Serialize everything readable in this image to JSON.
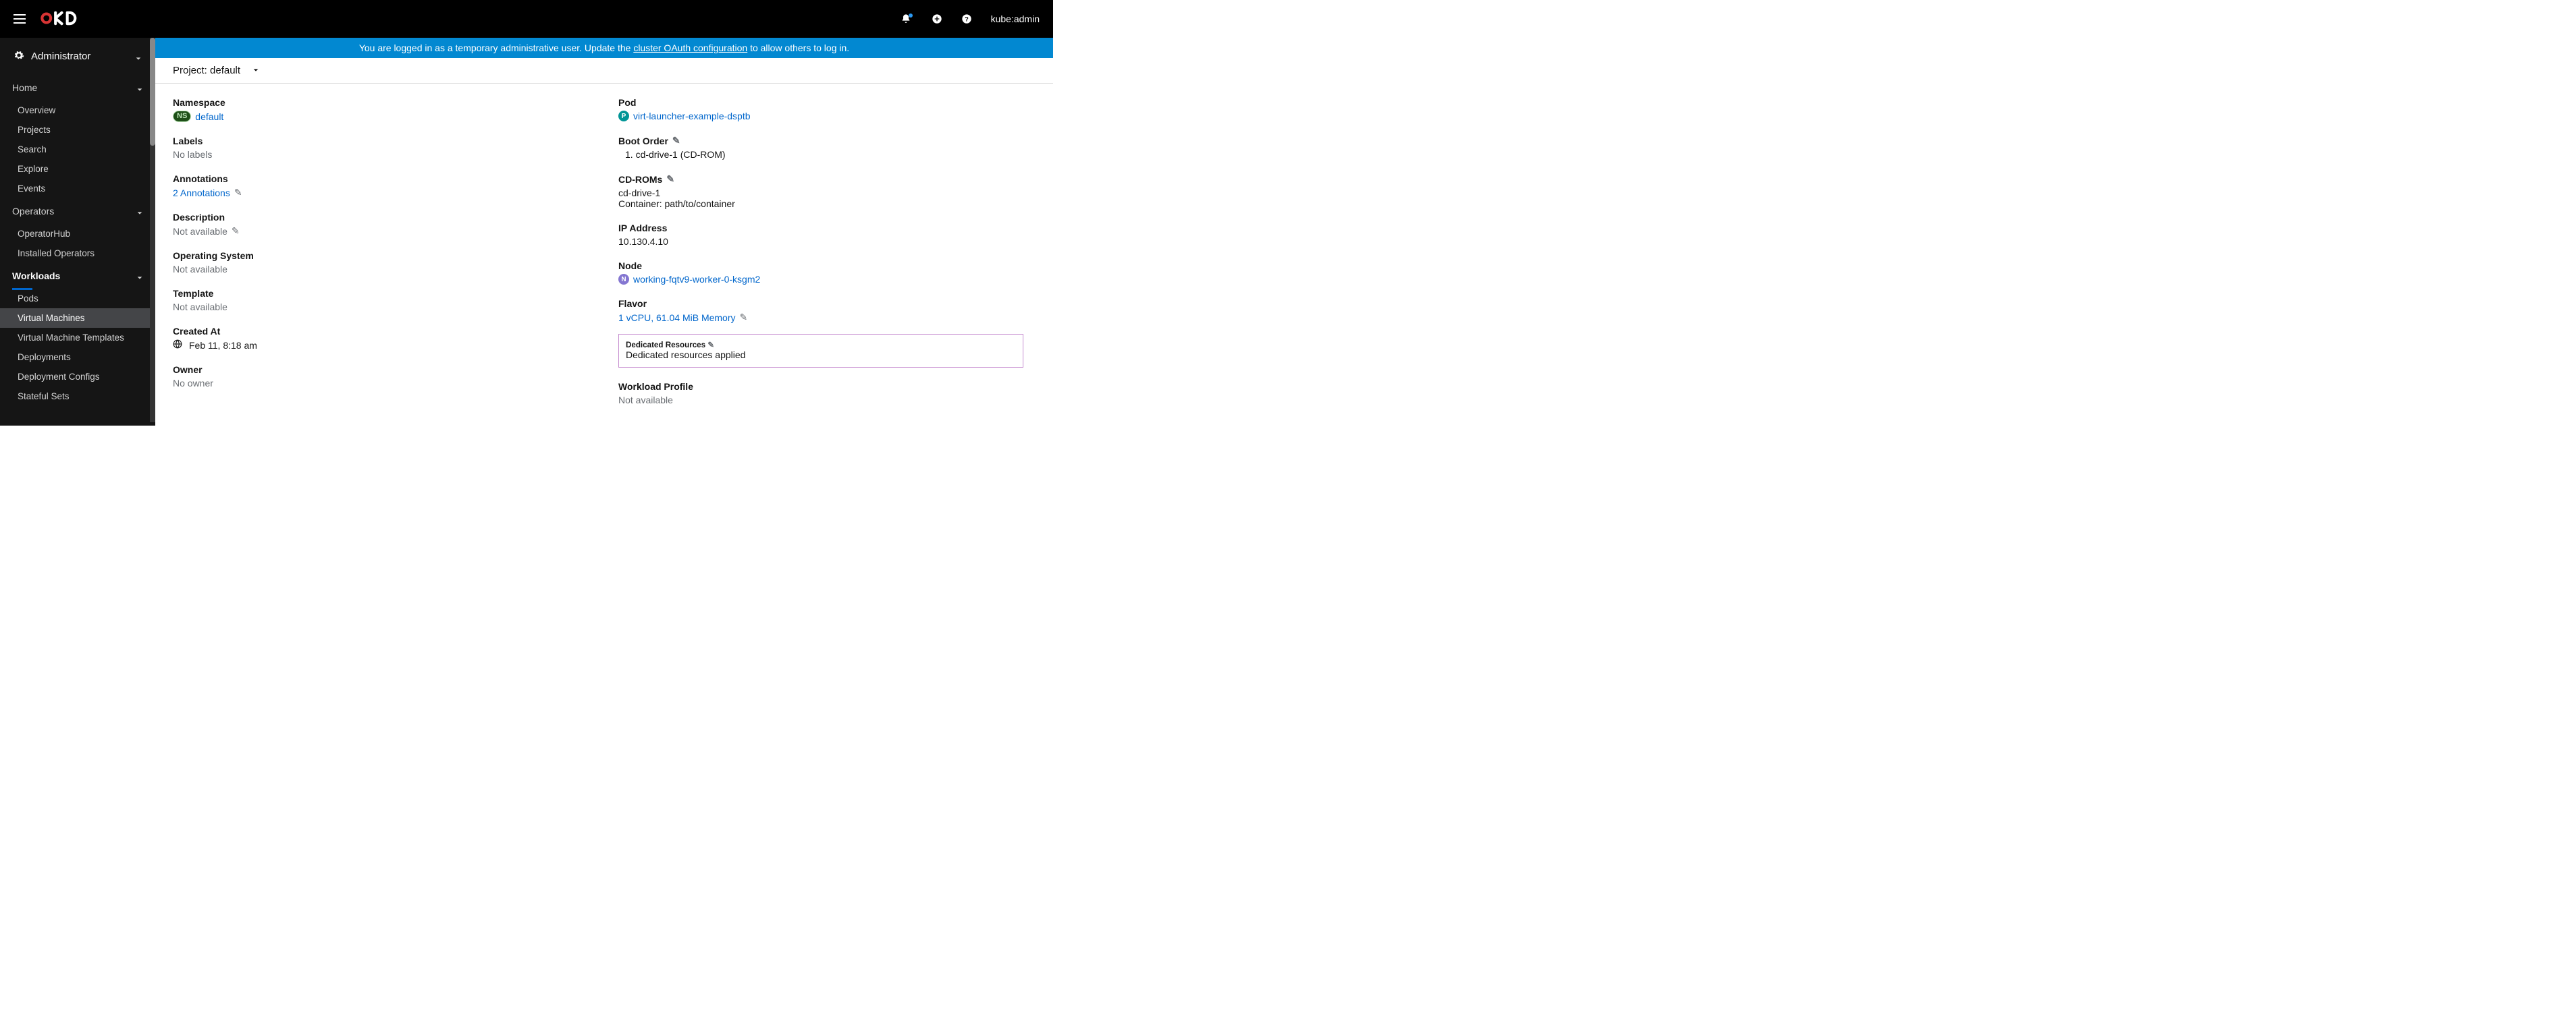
{
  "masthead": {
    "user": "kube:admin"
  },
  "banner": {
    "pre": "You are logged in as a temporary administrative user. Update the ",
    "link": "cluster OAuth configuration",
    "post": " to allow others to log in."
  },
  "perspective": "Administrator",
  "nav": {
    "home": {
      "label": "Home",
      "items": [
        "Overview",
        "Projects",
        "Search",
        "Explore",
        "Events"
      ]
    },
    "operators": {
      "label": "Operators",
      "items": [
        "OperatorHub",
        "Installed Operators"
      ]
    },
    "workloads": {
      "label": "Workloads",
      "items": [
        "Pods",
        "Virtual Machines",
        "Virtual Machine Templates",
        "Deployments",
        "Deployment Configs",
        "Stateful Sets"
      ]
    }
  },
  "project": {
    "label": "Project: default"
  },
  "left": {
    "namespace": {
      "label": "Namespace",
      "badge": "NS",
      "value": "default"
    },
    "labels": {
      "label": "Labels",
      "value": "No labels"
    },
    "annotations": {
      "label": "Annotations",
      "value": "2 Annotations"
    },
    "description": {
      "label": "Description",
      "value": "Not available"
    },
    "os": {
      "label": "Operating System",
      "value": "Not available"
    },
    "template": {
      "label": "Template",
      "value": "Not available"
    },
    "created": {
      "label": "Created At",
      "value": "Feb 11, 8:18 am"
    },
    "owner": {
      "label": "Owner",
      "value": "No owner"
    }
  },
  "right": {
    "pod": {
      "label": "Pod",
      "value": "virt-launcher-example-dsptb"
    },
    "boot": {
      "label": "Boot Order",
      "value": "1. cd-drive-1 (CD-ROM)"
    },
    "cdrom": {
      "label": "CD-ROMs",
      "v1": "cd-drive-1",
      "v2": "Container: path/to/container"
    },
    "ip": {
      "label": "IP Address",
      "value": "10.130.4.10"
    },
    "node": {
      "label": "Node",
      "value": "working-fqtv9-worker-0-ksgm2"
    },
    "flavor": {
      "label": "Flavor",
      "value": "1 vCPU, 61.04 MiB Memory"
    },
    "dedicated": {
      "label": "Dedicated Resources",
      "value": "Dedicated resources applied"
    },
    "workload": {
      "label": "Workload Profile",
      "value": "Not available"
    }
  }
}
